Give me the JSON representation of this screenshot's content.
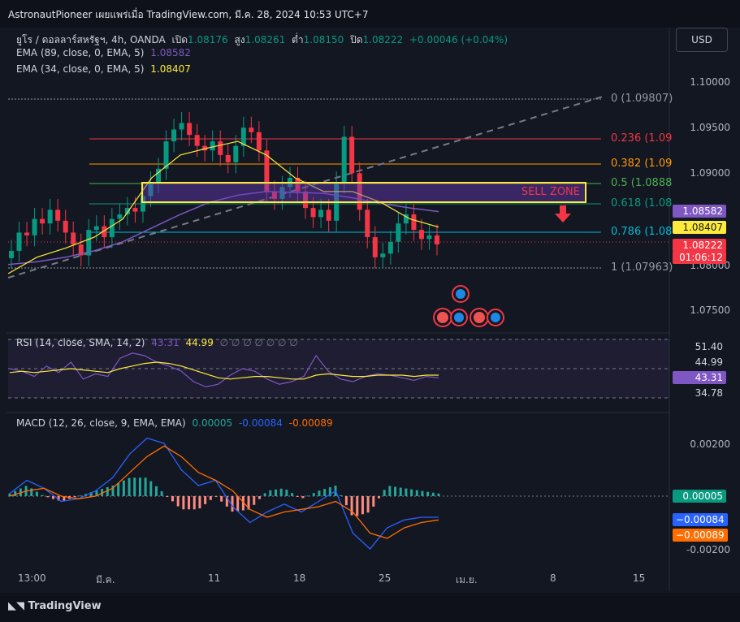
{
  "header": {
    "title": "AstronautPioneer เผยแพร่เมื่อ TradingView.com, มี.ค. 28, 2024 10:53 UTC+7"
  },
  "main": {
    "symbol_line": {
      "symbol": "ยูโร / ดอลลาร์สหรัฐฯ, 4h, OANDA",
      "open_label": "เปิด",
      "open": "1.08176",
      "high_label": "สูง",
      "high": "1.08261",
      "low_label": "ต่ำ",
      "low": "1.08150",
      "close_label": "ปิด",
      "close": "1.08222",
      "change": "+0.00046 (+0.04%)"
    },
    "ema89": {
      "label": "EMA (89, close, 0, EMA, 5)",
      "value": "1.08582"
    },
    "ema34": {
      "label": "EMA (34, close, 0, EMA, 5)",
      "value": "1.08407"
    },
    "currency_button": "USD",
    "price_axis": [
      "1.10000",
      "1.09500",
      "1.09000",
      "1.08000",
      "1.07500"
    ],
    "fib_levels": [
      {
        "label": "0 (1.09807)",
        "color": "#9598a1"
      },
      {
        "label": "0.236 (1.09",
        "color": "#f23645"
      },
      {
        "label": "0.382 (1.09",
        "color": "#ff9800"
      },
      {
        "label": "0.5 (1.0888",
        "color": "#4caf50"
      },
      {
        "label": "0.618 (1.08",
        "color": "#089981"
      },
      {
        "label": "0.786 (1.08",
        "color": "#00bcd4"
      },
      {
        "label": "1 (1.07963)",
        "color": "#9598a1"
      }
    ],
    "sell_zone_label": "SELL ZONE",
    "tags": {
      "ema89": "1.08582",
      "ema34": "1.08407",
      "last_price": "1.08222",
      "countdown": "01:06:12"
    }
  },
  "rsi": {
    "label": "RSI (14, close, SMA, 14, 2)",
    "value1": "43.31",
    "value2": "44.99",
    "zeros": "∅ ∅ ∅ ∅ ∅ ∅ ∅",
    "tags": [
      "51.40",
      "44.99",
      "43.31",
      "34.78"
    ]
  },
  "macd": {
    "label": "MACD (12, 26, close, 9, EMA, EMA)",
    "hist": "0.00005",
    "macd": "-0.00084",
    "signal": "-0.00089",
    "axis": [
      "0.00200",
      "-0.00200"
    ],
    "tags": [
      "0.00005",
      "−0.00084",
      "−0.00089"
    ]
  },
  "x_axis": [
    "13:00",
    "มี.ค.",
    "11",
    "18",
    "25",
    "เม.ย.",
    "8",
    "15"
  ],
  "footer": {
    "brand": "TradingView"
  },
  "colors": {
    "bull": "#089981",
    "bear": "#f23645",
    "ema89": "#7e57c2",
    "ema34": "#ffeb3b",
    "rsi": "#7e57c2",
    "macd": "#2962ff",
    "signal": "#ff6d00"
  },
  "chart_data": {
    "type": "line",
    "symbol": "EURUSD",
    "timeframe": "4h",
    "ylim": [
      1.074,
      1.1015
    ],
    "x": [
      "13:00",
      "มี.ค.",
      "11",
      "18",
      "25",
      "เม.ย.",
      "8",
      "15"
    ],
    "series": [
      {
        "name": "Close",
        "values": [
          1.0815,
          1.0835,
          1.0832,
          1.085,
          1.0845,
          1.086,
          1.0848,
          1.0835,
          1.0822,
          1.081,
          1.0838,
          1.0842,
          1.083,
          1.085,
          1.0855,
          1.0862,
          1.0858,
          1.0875,
          1.089,
          1.0905,
          1.0935,
          1.0948,
          1.0955,
          1.0942,
          1.093,
          1.0925,
          1.0935,
          1.092,
          1.0912,
          1.093,
          1.095,
          1.0945,
          1.0925,
          1.088,
          1.0872,
          1.0885,
          1.0895,
          1.088,
          1.0862,
          1.0852,
          1.086,
          1.0848,
          1.089,
          1.094,
          1.09,
          1.086,
          1.083,
          1.0808,
          1.0812,
          1.0825,
          1.0845,
          1.0855,
          1.0838,
          1.0828,
          1.0832,
          1.0822
        ]
      },
      {
        "name": "EMA 89",
        "values": [
          1.08,
          1.0803,
          1.0808,
          1.0815,
          1.0825,
          1.084,
          1.0855,
          1.0868,
          1.0876,
          1.088,
          1.0879,
          1.0878,
          1.0873,
          1.0867,
          1.0862,
          1.0858
        ]
      },
      {
        "name": "EMA 34",
        "values": [
          1.079,
          1.0808,
          1.0818,
          1.083,
          1.085,
          1.0895,
          1.092,
          1.0928,
          1.0935,
          1.092,
          1.0895,
          1.088,
          1.088,
          1.0868,
          1.085,
          1.0841
        ]
      }
    ]
  }
}
